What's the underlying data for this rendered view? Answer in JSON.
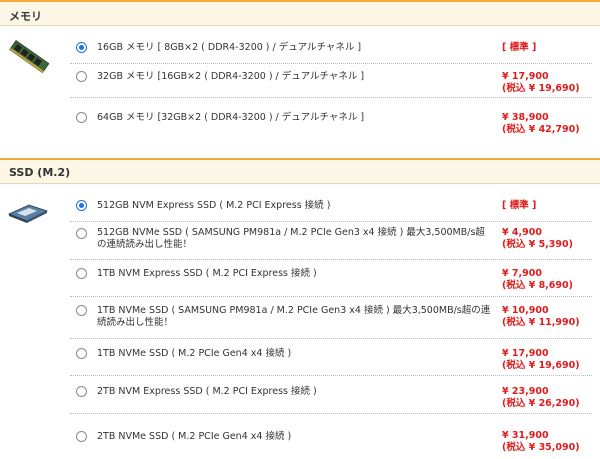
{
  "memory": {
    "title": "メモリ",
    "icon": "ram-module-icon",
    "options": [
      {
        "label": "16GB メモリ [ 8GB×2 ( DDR4-3200 ) / デュアルチャネル ]",
        "selected": true,
        "price": "[ 標準 ]",
        "price_tax": ""
      },
      {
        "label": "32GB メモリ [16GB×2 ( DDR4-3200 ) / デュアルチャネル ]",
        "selected": false,
        "price": "¥ 17,900",
        "price_tax": "(税込 ¥ 19,690)"
      },
      {
        "label": "64GB メモリ [32GB×2 ( DDR4-3200 ) / デュアルチャネル ]",
        "selected": false,
        "price": "¥ 38,900",
        "price_tax": "(税込 ¥ 42,790)"
      }
    ]
  },
  "ssd": {
    "title": "SSD (M.2)",
    "icon": "m2-ssd-icon",
    "options": [
      {
        "label": "512GB NVM Express SSD ( M.2 PCI Express 接続 )",
        "selected": true,
        "price": "[ 標準 ]",
        "price_tax": ""
      },
      {
        "label": "512GB NVMe SSD ( SAMSUNG PM981a / M.2 PCIe Gen3 x4 接続 ) 最大3,500MB/s超の連続読み出し性能！",
        "selected": false,
        "price": "¥ 4,900",
        "price_tax": "(税込 ¥ 5,390)"
      },
      {
        "label": "1TB NVM Express SSD ( M.2 PCI Express 接続 )",
        "selected": false,
        "price": "¥ 7,900",
        "price_tax": "(税込 ¥ 8,690)"
      },
      {
        "label": "1TB NVMe SSD ( SAMSUNG PM981a / M.2 PCIe Gen3 x4 接続 ) 最大3,500MB/s超の連続読み出し性能！",
        "selected": false,
        "price": "¥ 10,900",
        "price_tax": "(税込 ¥ 11,990)"
      },
      {
        "label": "1TB NVMe SSD ( M.2 PCIe Gen4 x4 接続 )",
        "selected": false,
        "price": "¥ 17,900",
        "price_tax": "(税込 ¥ 19,690)"
      },
      {
        "label": "2TB NVM Express SSD ( M.2 PCI Express 接続 )",
        "selected": false,
        "price": "¥ 23,900",
        "price_tax": "(税込 ¥ 26,290)"
      },
      {
        "label": "2TB NVMe SSD ( M.2 PCIe Gen4 x4 接続 )",
        "selected": false,
        "price": "¥ 31,900",
        "price_tax": "(税込 ¥ 35,090)"
      }
    ]
  },
  "colors": {
    "accent": "#f2a93b",
    "header_bg": "#fcf6e6",
    "price": "#e21b1b",
    "radio": "#1a73e8"
  }
}
